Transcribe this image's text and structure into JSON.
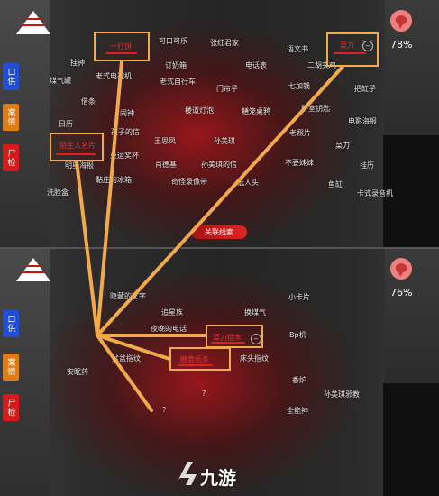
{
  "top": {
    "tabs": [
      "口供",
      "案情",
      "尸检"
    ],
    "sanity_percent": "78%",
    "link_button": "关联线索",
    "highlighted": [
      "一打饼",
      "菜刀",
      "陌生人名片"
    ],
    "clues": [
      "可口可乐",
      "张红君家",
      "语文书",
      "挂钟",
      "老式电视机",
      "订奶箱",
      "电话表",
      "二胡夹鸡",
      "煤气罐",
      "老式自行车",
      "门帘子",
      "七加钱",
      "把缸子",
      "借条",
      "闹钟",
      "楼道灯泡",
      "鳝笼桌鸦",
      "卧室钥匙",
      "日历",
      "电影海报",
      "孩子的信",
      "王思凤",
      "孙美琪",
      "老照片",
      "菜刀",
      "亚运奖杯",
      "肖德基",
      "孙美琪的信",
      "不要妹妹",
      "挂历",
      "明星海报",
      "黏庄的冰箱",
      "奇怪录像带",
      "纸人头",
      "鱼缸",
      "洗脸盒",
      "卡式录音机"
    ]
  },
  "bottom": {
    "tabs": [
      "口供",
      "案情",
      "尸检"
    ],
    "sanity_percent": "76%",
    "highlighted": [
      "菜刀插木",
      "糖食纸条"
    ],
    "clues": [
      "隐藏的文字",
      "小卡片",
      "追星族",
      "换煤气",
      "夜晚的电话",
      "Bp机",
      "床头指纹",
      "盆盆指纹",
      "安眠药",
      "香炉",
      "孙美琪邪教",
      "全能神",
      "?",
      "?"
    ]
  },
  "watermark": {
    "text": "九游"
  }
}
